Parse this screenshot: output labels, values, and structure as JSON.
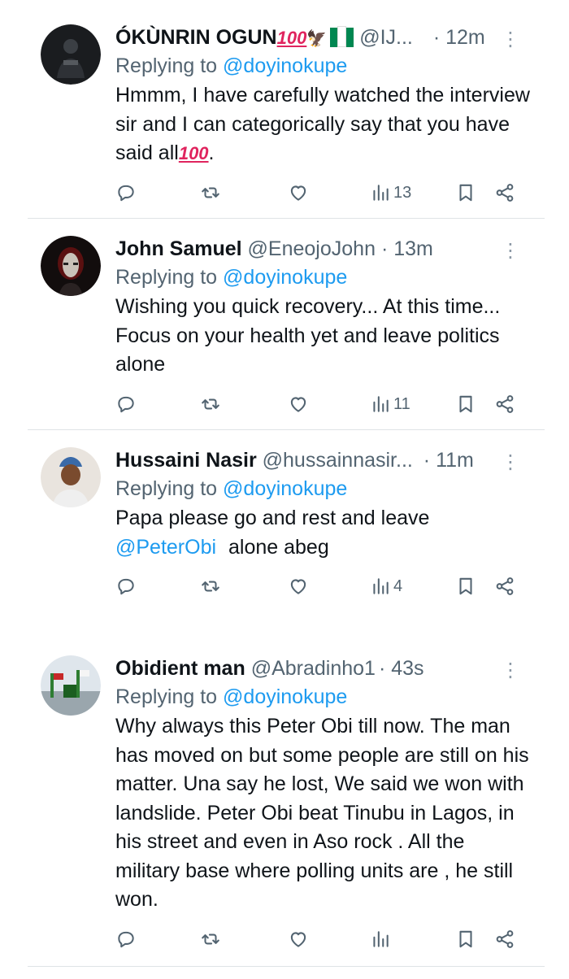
{
  "tweets": [
    {
      "name": "ÓKÙNRIN OGUN",
      "name_emoji": "💯🦅▮▮",
      "handle": "@IJ...",
      "time": "· 12m",
      "replying_prefix": "Replying to ",
      "replying_to": "@doyinokupe",
      "text": "Hmmm, I have carefully watched the interview sir and I can categorically say that you have said all",
      "text_suffix": "💯",
      "text_end": ".",
      "views": "13"
    },
    {
      "name": "John Samuel",
      "handle": "@EneojoJohn",
      "time": "· 13m",
      "replying_prefix": "Replying to ",
      "replying_to": "@doyinokupe",
      "text": "Wishing you quick recovery... At this time... Focus on your health yet and leave politics alone",
      "views": "11"
    },
    {
      "name": "Hussaini Nasir",
      "handle": "@hussainnasir...",
      "time": "· 11m",
      "replying_prefix": "Replying to ",
      "replying_to": "@doyinokupe",
      "text_line1": "Papa please go and rest and leave",
      "text_mention": "@PeterObi",
      "text_line2_rest": " alone abeg",
      "views": "4"
    },
    {
      "name": "Obidient man",
      "handle": "@Abradinho1",
      "time": "· 43s",
      "replying_prefix": "Replying to ",
      "replying_to": "@doyinokupe",
      "text": "Why always this Peter Obi till now. The man has moved on but some people are still on his matter. Una say he lost, We said we won with landslide. Peter Obi beat Tinubu in Lagos, in his street and even in Aso rock . All the military base where polling units are , he still won.",
      "views": ""
    }
  ],
  "more_icon": "⋮",
  "colors": {
    "link": "#1d9bf0",
    "secondary": "#536471",
    "text": "#0f1419",
    "divider": "#dfe3e6"
  }
}
